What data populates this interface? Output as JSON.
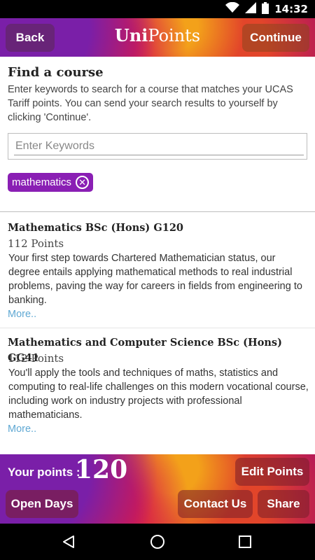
{
  "status_bar": {
    "time": "14:32",
    "icons": [
      "wifi-icon",
      "signal-icon",
      "battery-icon"
    ]
  },
  "header": {
    "back_label": "Back",
    "logo_bold": "Uni",
    "logo_regular": "Points",
    "continue_label": "Continue"
  },
  "search": {
    "title": "Find a course",
    "description": "Enter keywords to search for a course that matches your UCAS Tariff points. You can send your search results to yourself by clicking 'Continue'.",
    "placeholder": "Enter Keywords",
    "value": "",
    "tags": [
      {
        "label": "mathematics"
      }
    ]
  },
  "results": [
    {
      "title": "Mathematics BSc (Hons) G120",
      "points": "112 Points",
      "description": "Your first step towards Chartered Mathematician status, our degree entails applying mathematical methods to real industrial problems, paving the way for careers in fields from engineering to banking.",
      "more_label": "More.."
    },
    {
      "title": "Mathematics and Computer Science BSc (Hons) GG41",
      "points": "112 Points",
      "description": "You'll apply the tools and techniques of maths, statistics and computing to real-life challenges on this modern vocational course, including work on industry projects with professional mathematicians.",
      "more_label": "More.."
    }
  ],
  "footer": {
    "points_label": "Your points :",
    "points_value": "120",
    "edit_label": "Edit Points",
    "open_days_label": "Open Days",
    "contact_label": "Contact Us",
    "share_label": "Share"
  },
  "nav": {
    "icons": [
      "back-triangle-icon",
      "home-circle-icon",
      "recents-square-icon"
    ]
  },
  "colors": {
    "accent": "#8a1fb4",
    "link": "#5fa8d3"
  }
}
